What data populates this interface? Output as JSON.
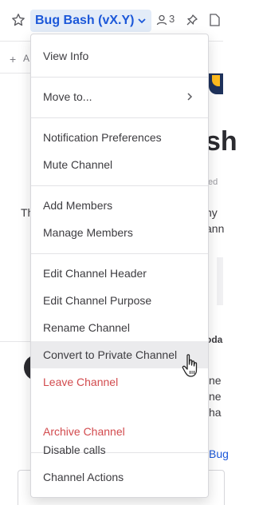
{
  "header": {
    "channel_title": "Bug Bash (vX.Y)",
    "member_count": "3",
    "icons": [
      "star-icon",
      "chevron-down-icon",
      "member-icon",
      "pin-icon",
      "files-icon"
    ]
  },
  "add_row": {
    "text": "A"
  },
  "background": {
    "big_text": "sh",
    "small_text": "ted",
    "left_text": "Th",
    "right_line1": "ny",
    "right_line2": "ann",
    "today": "oda",
    "line3": "ne",
    "line4": "ne",
    "line5": "ha",
    "link": "Bug"
  },
  "menu": {
    "view_info": "View Info",
    "move_to": "Move to...",
    "notification_prefs": "Notification Preferences",
    "mute_channel": "Mute Channel",
    "add_members": "Add Members",
    "manage_members": "Manage Members",
    "edit_header": "Edit Channel Header",
    "edit_purpose": "Edit Channel Purpose",
    "rename_channel": "Rename Channel",
    "convert_private": "Convert to Private Channel",
    "leave_channel": "Leave Channel",
    "archive_channel": "Archive Channel",
    "disable_calls": "Disable calls",
    "channel_actions": "Channel Actions"
  },
  "colors": {
    "accent": "#1c58d9",
    "danger": "#d24b4e",
    "hover": "#ebebed"
  }
}
